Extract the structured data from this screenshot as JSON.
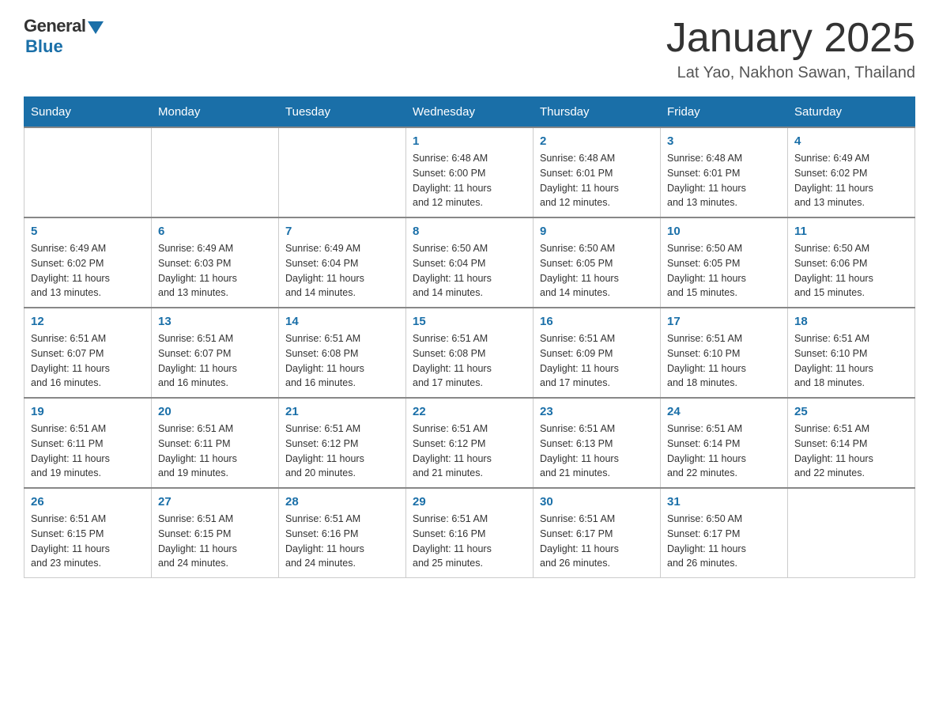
{
  "header": {
    "logo_general": "General",
    "logo_blue": "Blue",
    "month_title": "January 2025",
    "subtitle": "Lat Yao, Nakhon Sawan, Thailand"
  },
  "calendar": {
    "days_of_week": [
      "Sunday",
      "Monday",
      "Tuesday",
      "Wednesday",
      "Thursday",
      "Friday",
      "Saturday"
    ],
    "weeks": [
      [
        {
          "day": "",
          "info": ""
        },
        {
          "day": "",
          "info": ""
        },
        {
          "day": "",
          "info": ""
        },
        {
          "day": "1",
          "info": "Sunrise: 6:48 AM\nSunset: 6:00 PM\nDaylight: 11 hours\nand 12 minutes."
        },
        {
          "day": "2",
          "info": "Sunrise: 6:48 AM\nSunset: 6:01 PM\nDaylight: 11 hours\nand 12 minutes."
        },
        {
          "day": "3",
          "info": "Sunrise: 6:48 AM\nSunset: 6:01 PM\nDaylight: 11 hours\nand 13 minutes."
        },
        {
          "day": "4",
          "info": "Sunrise: 6:49 AM\nSunset: 6:02 PM\nDaylight: 11 hours\nand 13 minutes."
        }
      ],
      [
        {
          "day": "5",
          "info": "Sunrise: 6:49 AM\nSunset: 6:02 PM\nDaylight: 11 hours\nand 13 minutes."
        },
        {
          "day": "6",
          "info": "Sunrise: 6:49 AM\nSunset: 6:03 PM\nDaylight: 11 hours\nand 13 minutes."
        },
        {
          "day": "7",
          "info": "Sunrise: 6:49 AM\nSunset: 6:04 PM\nDaylight: 11 hours\nand 14 minutes."
        },
        {
          "day": "8",
          "info": "Sunrise: 6:50 AM\nSunset: 6:04 PM\nDaylight: 11 hours\nand 14 minutes."
        },
        {
          "day": "9",
          "info": "Sunrise: 6:50 AM\nSunset: 6:05 PM\nDaylight: 11 hours\nand 14 minutes."
        },
        {
          "day": "10",
          "info": "Sunrise: 6:50 AM\nSunset: 6:05 PM\nDaylight: 11 hours\nand 15 minutes."
        },
        {
          "day": "11",
          "info": "Sunrise: 6:50 AM\nSunset: 6:06 PM\nDaylight: 11 hours\nand 15 minutes."
        }
      ],
      [
        {
          "day": "12",
          "info": "Sunrise: 6:51 AM\nSunset: 6:07 PM\nDaylight: 11 hours\nand 16 minutes."
        },
        {
          "day": "13",
          "info": "Sunrise: 6:51 AM\nSunset: 6:07 PM\nDaylight: 11 hours\nand 16 minutes."
        },
        {
          "day": "14",
          "info": "Sunrise: 6:51 AM\nSunset: 6:08 PM\nDaylight: 11 hours\nand 16 minutes."
        },
        {
          "day": "15",
          "info": "Sunrise: 6:51 AM\nSunset: 6:08 PM\nDaylight: 11 hours\nand 17 minutes."
        },
        {
          "day": "16",
          "info": "Sunrise: 6:51 AM\nSunset: 6:09 PM\nDaylight: 11 hours\nand 17 minutes."
        },
        {
          "day": "17",
          "info": "Sunrise: 6:51 AM\nSunset: 6:10 PM\nDaylight: 11 hours\nand 18 minutes."
        },
        {
          "day": "18",
          "info": "Sunrise: 6:51 AM\nSunset: 6:10 PM\nDaylight: 11 hours\nand 18 minutes."
        }
      ],
      [
        {
          "day": "19",
          "info": "Sunrise: 6:51 AM\nSunset: 6:11 PM\nDaylight: 11 hours\nand 19 minutes."
        },
        {
          "day": "20",
          "info": "Sunrise: 6:51 AM\nSunset: 6:11 PM\nDaylight: 11 hours\nand 19 minutes."
        },
        {
          "day": "21",
          "info": "Sunrise: 6:51 AM\nSunset: 6:12 PM\nDaylight: 11 hours\nand 20 minutes."
        },
        {
          "day": "22",
          "info": "Sunrise: 6:51 AM\nSunset: 6:12 PM\nDaylight: 11 hours\nand 21 minutes."
        },
        {
          "day": "23",
          "info": "Sunrise: 6:51 AM\nSunset: 6:13 PM\nDaylight: 11 hours\nand 21 minutes."
        },
        {
          "day": "24",
          "info": "Sunrise: 6:51 AM\nSunset: 6:14 PM\nDaylight: 11 hours\nand 22 minutes."
        },
        {
          "day": "25",
          "info": "Sunrise: 6:51 AM\nSunset: 6:14 PM\nDaylight: 11 hours\nand 22 minutes."
        }
      ],
      [
        {
          "day": "26",
          "info": "Sunrise: 6:51 AM\nSunset: 6:15 PM\nDaylight: 11 hours\nand 23 minutes."
        },
        {
          "day": "27",
          "info": "Sunrise: 6:51 AM\nSunset: 6:15 PM\nDaylight: 11 hours\nand 24 minutes."
        },
        {
          "day": "28",
          "info": "Sunrise: 6:51 AM\nSunset: 6:16 PM\nDaylight: 11 hours\nand 24 minutes."
        },
        {
          "day": "29",
          "info": "Sunrise: 6:51 AM\nSunset: 6:16 PM\nDaylight: 11 hours\nand 25 minutes."
        },
        {
          "day": "30",
          "info": "Sunrise: 6:51 AM\nSunset: 6:17 PM\nDaylight: 11 hours\nand 26 minutes."
        },
        {
          "day": "31",
          "info": "Sunrise: 6:50 AM\nSunset: 6:17 PM\nDaylight: 11 hours\nand 26 minutes."
        },
        {
          "day": "",
          "info": ""
        }
      ]
    ]
  }
}
